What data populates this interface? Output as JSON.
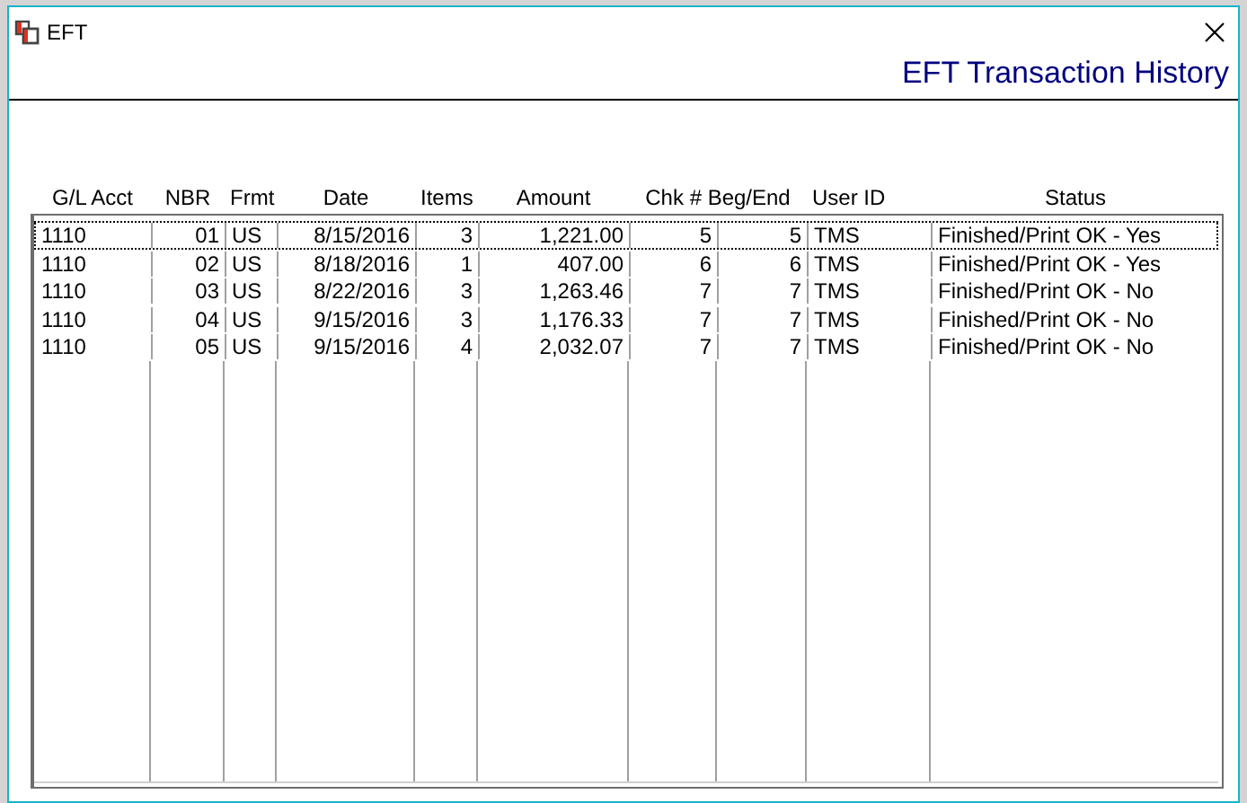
{
  "window": {
    "title": "EFT"
  },
  "heading": "EFT Transaction History",
  "table": {
    "columns": [
      "G/L Acct",
      "NBR",
      "Frmt",
      "Date",
      "Items",
      "Amount",
      "Chk # Beg/End",
      "User ID",
      "Status"
    ],
    "rows": [
      {
        "selected": true,
        "cells": [
          "1110",
          "01",
          "US",
          "8/15/2016",
          "3",
          "1,221.00",
          [
            "5",
            "5"
          ],
          "TMS",
          "Finished/Print OK - Yes"
        ]
      },
      {
        "selected": false,
        "cells": [
          "1110",
          "02",
          "US",
          "8/18/2016",
          "1",
          "407.00",
          [
            "6",
            "6"
          ],
          "TMS",
          "Finished/Print OK - Yes"
        ]
      },
      {
        "selected": false,
        "cells": [
          "1110",
          "03",
          "US",
          "8/22/2016",
          "3",
          "1,263.46",
          [
            "7",
            "7"
          ],
          "TMS",
          "Finished/Print OK - No"
        ]
      },
      {
        "selected": false,
        "cells": [
          "1110",
          "04",
          "US",
          "9/15/2016",
          "3",
          "1,176.33",
          [
            "7",
            "7"
          ],
          "TMS",
          "Finished/Print OK - No"
        ]
      },
      {
        "selected": false,
        "cells": [
          "1110",
          "05",
          "US",
          "9/15/2016",
          "4",
          "2,032.07",
          [
            "7",
            "7"
          ],
          "TMS",
          "Finished/Print OK - No"
        ]
      }
    ]
  }
}
